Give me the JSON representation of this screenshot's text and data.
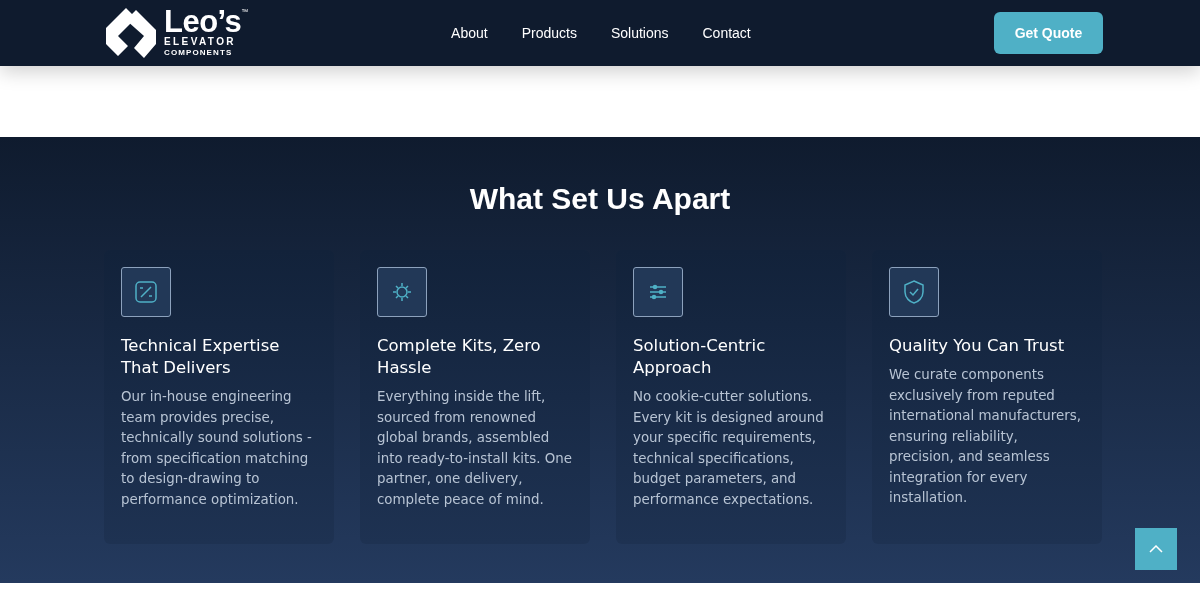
{
  "header": {
    "logo": {
      "name": "Leo’s",
      "trademark": "™",
      "line_1": "ELEVATOR",
      "line_2": "COMPONENTS"
    },
    "nav": [
      "About",
      "Products",
      "Solutions",
      "Contact"
    ],
    "cta": "Get Quote"
  },
  "section": {
    "title": "What Set Us Apart",
    "cards": [
      {
        "title": "Technical Expertise That Delivers",
        "text": "Our in-house engineering team provides precise, technically sound solutions - from specification matching to design-drawing to performance optimization."
      },
      {
        "title": "Complete Kits, Zero Hassle",
        "text": "Everything inside the lift, sourced from renowned global brands, assembled into ready-to-install kits. One partner, one delivery, complete peace of mind."
      },
      {
        "title": "Solution-Centric Approach",
        "text": "No cookie-cutter solutions. Every kit is designed around your specific requirements, technical specifications, budget parameters, and performance expectations."
      },
      {
        "title": "Quality You Can Trust",
        "text": "We curate components exclusively from reputed international manufacturers, ensuring reliability, precision, and seamless integration for every installation."
      }
    ]
  }
}
